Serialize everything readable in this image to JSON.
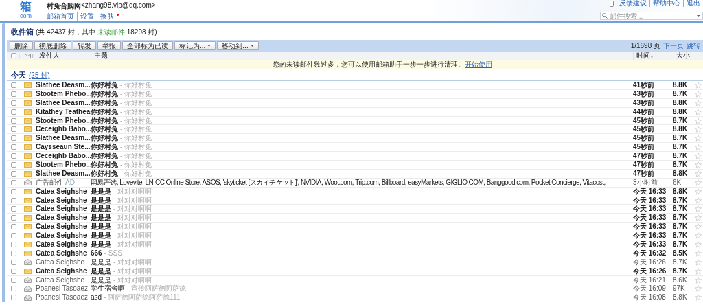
{
  "header": {
    "logo_text": "箱",
    "logo_sub": "com",
    "account_name": "村兔合购网",
    "account_email": "<zhang98.vip@qq.com>",
    "links": [
      "邮箱首页",
      "设置",
      "换肤"
    ],
    "skin_new": true,
    "top_links": [
      "反馈建议",
      "帮助中心",
      "退出"
    ],
    "search_placeholder": "邮件搜索..."
  },
  "folder": {
    "title": "收件箱",
    "count_prefix": "(共 42437 封，其中",
    "unread_label": "未读邮件",
    "count_suffix": "18298 封)"
  },
  "toolbar": [
    {
      "label": "删除",
      "dropdown": false
    },
    {
      "label": "彻底删除",
      "dropdown": false
    },
    {
      "label": "转发",
      "dropdown": false
    },
    {
      "label": "举报",
      "dropdown": false
    },
    {
      "label": "全部标为已读",
      "dropdown": false
    },
    {
      "label": "标记为...",
      "dropdown": true
    },
    {
      "label": "移动到...",
      "dropdown": true
    }
  ],
  "pager": {
    "page": "1/1698 页",
    "next": "下一页",
    "jump": "跳转"
  },
  "columns": {
    "sender": "发件人",
    "subject": "主题",
    "time": "时间↓",
    "size": "大小"
  },
  "select_all_checked": false,
  "notice": {
    "text": "您的未读邮件数过多，您可以使用邮箱助手一步一步进行清理。",
    "link": "开始使用"
  },
  "group": {
    "label": "今天",
    "count": "(25 封)"
  },
  "rows": [
    {
      "kind": "mail",
      "checked": false,
      "unread": true,
      "sender": "Slathee Deasm...",
      "subject": "你好村兔",
      "preview": "- 你好村兔",
      "time": "41秒前",
      "size": "8.8K"
    },
    {
      "kind": "mail",
      "checked": false,
      "unread": true,
      "sender": "Stootem Phebo...",
      "subject": "你好村兔",
      "preview": "- 你好村兔",
      "time": "43秒前",
      "size": "8.7K"
    },
    {
      "kind": "mail",
      "checked": false,
      "unread": true,
      "sender": "Slathee Deasm...",
      "subject": "你好村兔",
      "preview": "- 你好村兔",
      "time": "43秒前",
      "size": "8.8K"
    },
    {
      "kind": "mail",
      "checked": false,
      "unread": true,
      "sender": "Kitathey Teathea",
      "subject": "你好村兔",
      "preview": "- 你好村兔",
      "time": "44秒前",
      "size": "8.8K"
    },
    {
      "kind": "mail",
      "checked": false,
      "unread": true,
      "sender": "Stootem Phebo...",
      "subject": "你好村兔",
      "preview": "- 你好村兔",
      "time": "45秒前",
      "size": "8.7K"
    },
    {
      "kind": "mail",
      "checked": false,
      "unread": true,
      "sender": "Ceceighb Babo...",
      "subject": "你好村兔",
      "preview": "- 你好村兔",
      "time": "45秒前",
      "size": "8.8K"
    },
    {
      "kind": "mail",
      "checked": false,
      "unread": true,
      "sender": "Slathee Deasm...",
      "subject": "你好村兔",
      "preview": "- 你好村兔",
      "time": "45秒前",
      "size": "8.7K"
    },
    {
      "kind": "mail",
      "checked": false,
      "unread": true,
      "sender": "Caysseaun Ste...",
      "subject": "你好村兔",
      "preview": "- 你好村兔",
      "time": "45秒前",
      "size": "8.7K"
    },
    {
      "kind": "mail",
      "checked": false,
      "unread": true,
      "sender": "Ceceighb Babo...",
      "subject": "你好村兔",
      "preview": "- 你好村兔",
      "time": "47秒前",
      "size": "8.7K"
    },
    {
      "kind": "mail",
      "checked": false,
      "unread": true,
      "sender": "Stootem Phebo...",
      "subject": "你好村兔",
      "preview": "- 你好村兔",
      "time": "47秒前",
      "size": "8.7K"
    },
    {
      "kind": "mail",
      "checked": false,
      "unread": true,
      "sender": "Slathee Deasm...",
      "subject": "你好村兔",
      "preview": "- 你好村兔",
      "time": "47秒前",
      "size": "8.8K"
    },
    {
      "kind": "ad",
      "checked": false,
      "unread": false,
      "sender": "广告邮件",
      "tag": "AD",
      "subject": "网易严选, Lovevite, LN-CC Online Store, ASOS, 'skyticket [スカイチケット]', NVIDIA, Woot.com, Trip.com, Billboard, easyMarkets, GIGLIO.COM, Banggood.com, Pocket Concierge, Vitacost,",
      "time": "3小时前",
      "size": "6K"
    },
    {
      "kind": "mail",
      "checked": false,
      "unread": true,
      "sender": "Catea Seighshe",
      "subject": "是是是",
      "preview": "- 对对对啊啊",
      "time": "今天 16:33",
      "size": "8.8K"
    },
    {
      "kind": "mail",
      "checked": false,
      "unread": true,
      "sender": "Catea Seighshe",
      "subject": "是是是",
      "preview": "- 对对对啊啊",
      "time": "今天 16:33",
      "size": "8.7K"
    },
    {
      "kind": "mail",
      "checked": false,
      "unread": true,
      "sender": "Catea Seighshe",
      "subject": "是是是",
      "preview": "- 对对对啊啊",
      "time": "今天 16:33",
      "size": "8.7K"
    },
    {
      "kind": "mail",
      "checked": false,
      "unread": true,
      "sender": "Catea Seighshe",
      "subject": "是是是",
      "preview": "- 对对对啊啊",
      "time": "今天 16:33",
      "size": "8.7K"
    },
    {
      "kind": "mail",
      "checked": false,
      "unread": true,
      "sender": "Catea Seighshe",
      "subject": "是是是",
      "preview": "- 对对对啊啊",
      "time": "今天 16:33",
      "size": "8.7K"
    },
    {
      "kind": "mail",
      "checked": false,
      "unread": true,
      "sender": "Catea Seighshe",
      "subject": "是是是",
      "preview": "- 对对对啊啊",
      "time": "今天 16:33",
      "size": "8.7K"
    },
    {
      "kind": "mail",
      "checked": false,
      "unread": true,
      "sender": "Catea Seighshe",
      "subject": "是是是",
      "preview": "- 对对对啊啊",
      "time": "今天 16:33",
      "size": "8.7K"
    },
    {
      "kind": "mail",
      "checked": false,
      "unread": true,
      "sender": "Catea Seighshe",
      "subject": "666",
      "preview": "- SSS",
      "time": "今天 16:32",
      "size": "8.5K"
    },
    {
      "kind": "mail",
      "checked": false,
      "unread": false,
      "sender": "Catea Seighshe",
      "subject": "是是是",
      "preview": "- 对对对啊啊",
      "time": "今天 16:26",
      "size": "8.7K"
    },
    {
      "kind": "mail",
      "checked": false,
      "unread": true,
      "sender": "Catea Seighshe",
      "subject": "是是是",
      "preview": "- 对对对啊啊",
      "time": "今天 16:26",
      "size": "8.7K"
    },
    {
      "kind": "mail",
      "checked": false,
      "unread": false,
      "sender": "Catea Seighshe",
      "subject": "是是是",
      "preview": "- 对对对啊啊",
      "time": "今天 16:21",
      "size": "8.6K"
    },
    {
      "kind": "mail",
      "checked": false,
      "unread": false,
      "sender": "Poanesl Tasoaez",
      "subject": "学生宿舍啊",
      "preview": "- 宣传阿萨德阿萨德",
      "time": "今天 16:09",
      "size": "97K"
    },
    {
      "kind": "mail",
      "checked": false,
      "unread": false,
      "sender": "Poanesl Tasoaez",
      "subject": "asd",
      "preview": "- 阿萨德阿萨德阿萨德111",
      "time": "今天 16:08",
      "size": "8.8K"
    }
  ]
}
